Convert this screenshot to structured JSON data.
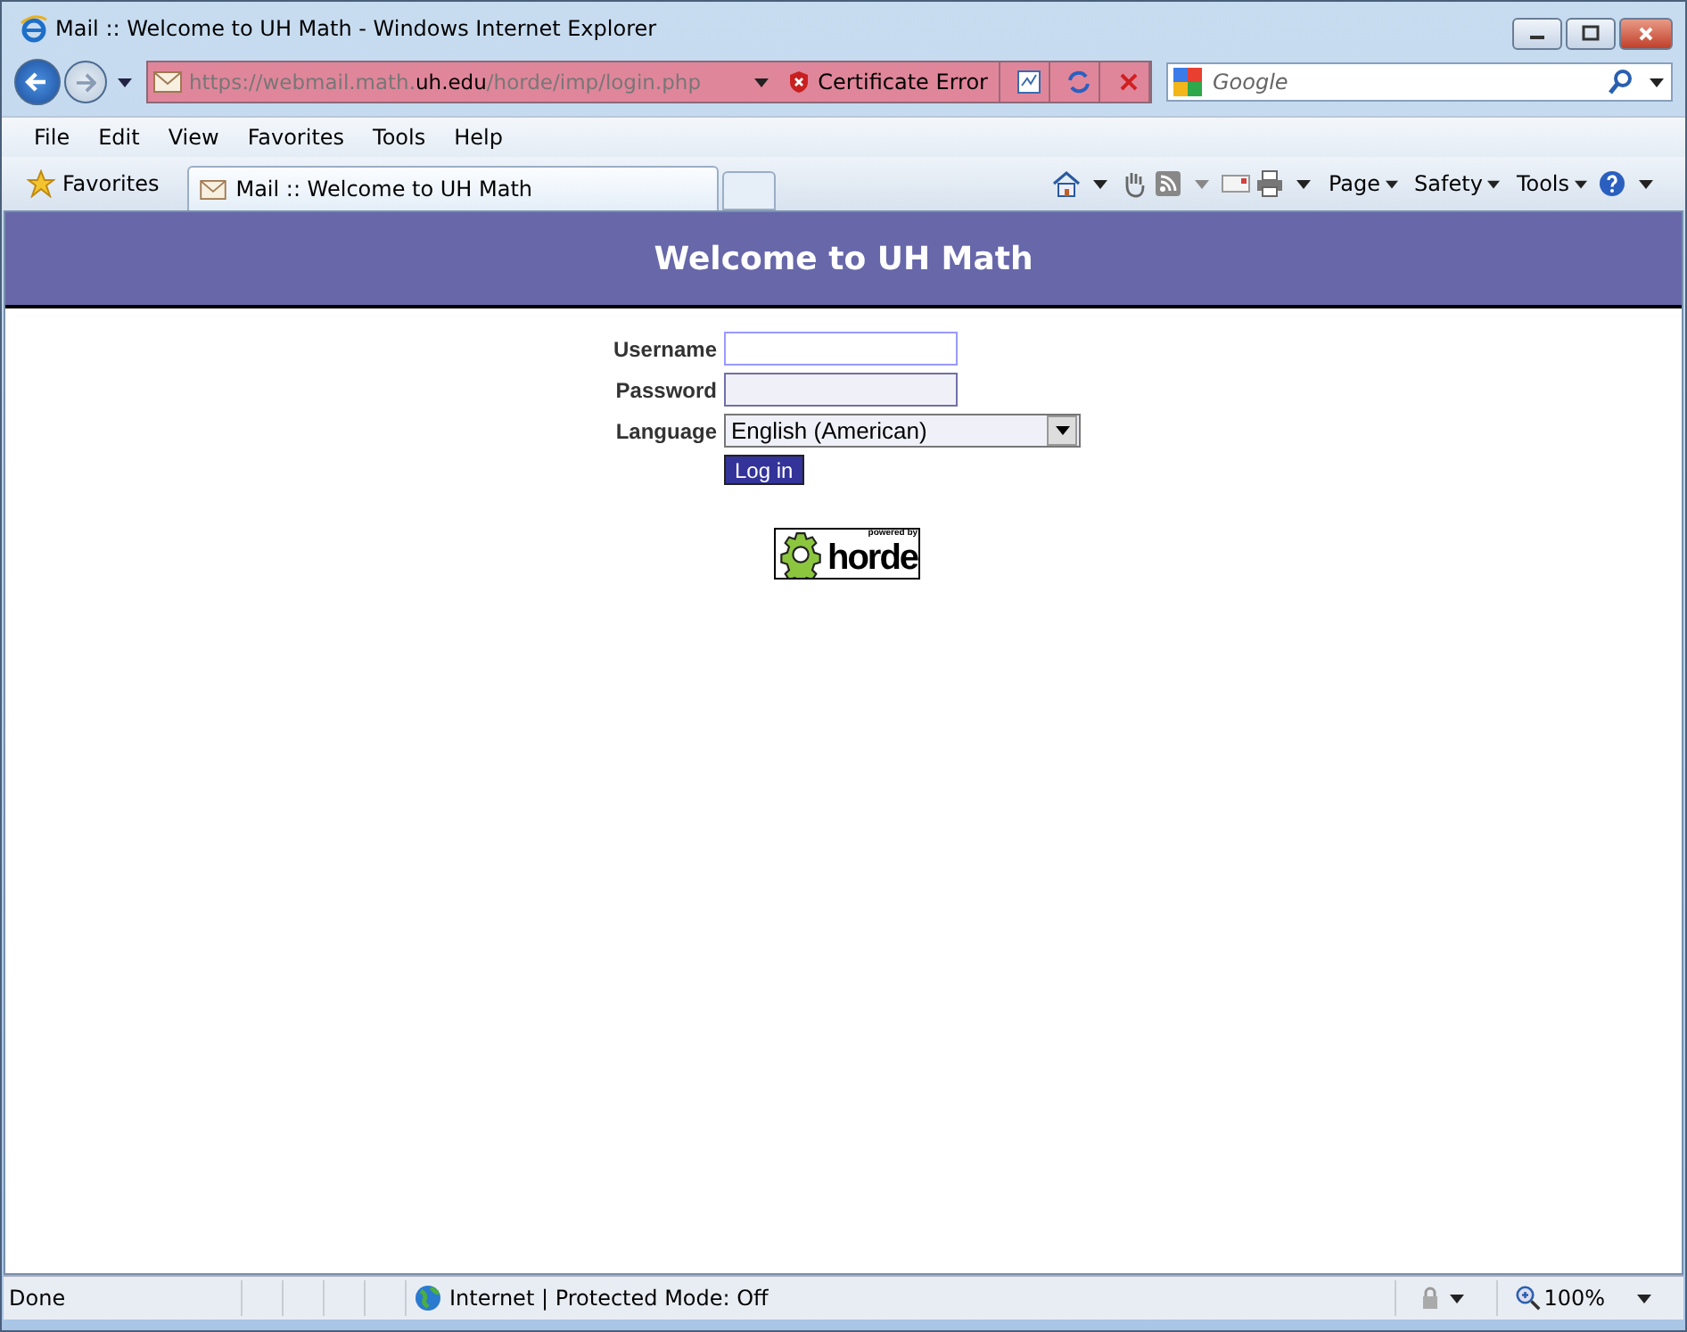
{
  "window": {
    "title": "Mail :: Welcome to UH Math - Windows Internet Explorer"
  },
  "address_bar": {
    "url_prefix": "https://webmail.math.",
    "url_domain": "uh.edu",
    "url_path": "/horde/imp/login.php",
    "certificate_error": "Certificate Error"
  },
  "search": {
    "placeholder": "Google"
  },
  "menu": [
    "File",
    "Edit",
    "View",
    "Favorites",
    "Tools",
    "Help"
  ],
  "favorites": {
    "label": "Favorites"
  },
  "tabs": [
    {
      "label": "Mail :: Welcome to UH Math",
      "selected": true
    }
  ],
  "command_bar": [
    "Page",
    "Safety",
    "Tools"
  ],
  "page": {
    "header": "Welcome to UH Math",
    "fields": [
      {
        "kind": "text",
        "label": "Username",
        "focused": true
      },
      {
        "kind": "password",
        "label": "Password",
        "focused": false
      },
      {
        "kind": "select",
        "label": "Language",
        "value": "English (American)"
      }
    ],
    "login_button": "Log in",
    "logo": {
      "top": "powered by",
      "word": "horde"
    }
  },
  "status_bar": {
    "text": "Done",
    "zone": "Internet | Protected Mode: Off",
    "zoom": "100%"
  }
}
